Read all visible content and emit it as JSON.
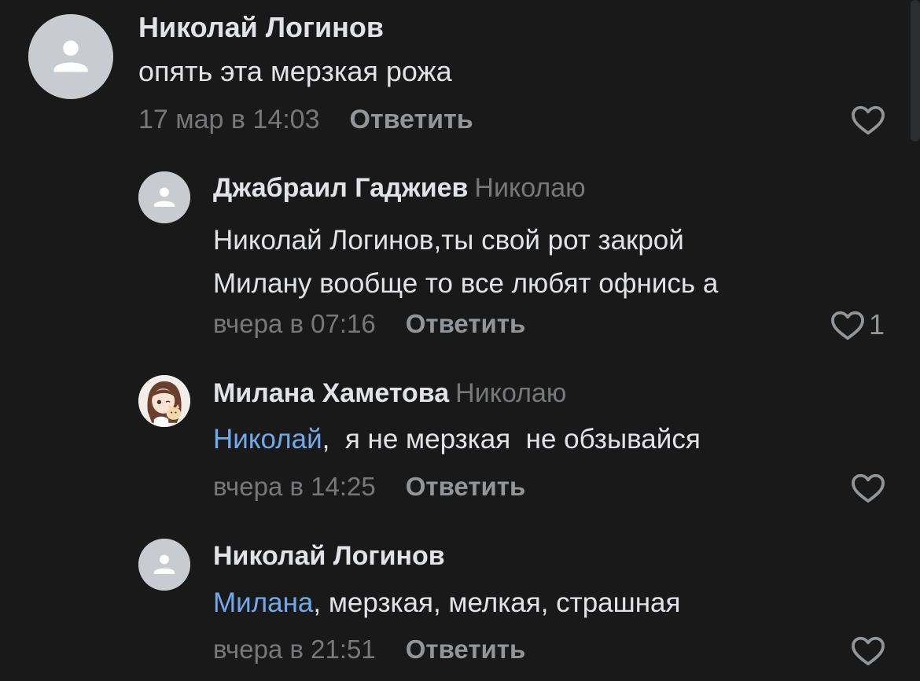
{
  "colors": {
    "background": "#19191a",
    "text_primary": "#e1e3e6",
    "text_secondary": "#76787a",
    "mention": "#71aaeb",
    "avatar_placeholder": "#c8cbd0"
  },
  "comments": [
    {
      "author": "Николай Логинов",
      "reply_to": "",
      "text_lines": [
        "опять эта мерзкая рожа"
      ],
      "time": "17 мар в 14:03",
      "reply_label": "Ответить",
      "likes": "",
      "avatar": "user-placeholder-icon"
    },
    {
      "author": "Джабраил Гаджиев",
      "reply_to": "Николаю",
      "text_lines": [
        "Николай Логинов,ты свой рот закрой",
        "Милану вообще то все любят офнись а"
      ],
      "time": "вчера в 07:16",
      "reply_label": "Ответить",
      "likes": "1",
      "avatar": "user-placeholder-icon"
    },
    {
      "author": "Милана Хаметова",
      "reply_to": "Николаю",
      "mention": "Николай",
      "text_rest": ",  я не мерзкая  не обзывайся",
      "time": "вчера в 14:25",
      "reply_label": "Ответить",
      "likes": "",
      "avatar": "anime-girl-avatar"
    },
    {
      "author": "Николай Логинов",
      "reply_to": "",
      "mention": "Милана",
      "text_rest": ", мерзкая, мелкая, страшная",
      "time": "вчера в 21:51",
      "reply_label": "Ответить",
      "likes": "",
      "avatar": "user-placeholder-icon"
    }
  ]
}
